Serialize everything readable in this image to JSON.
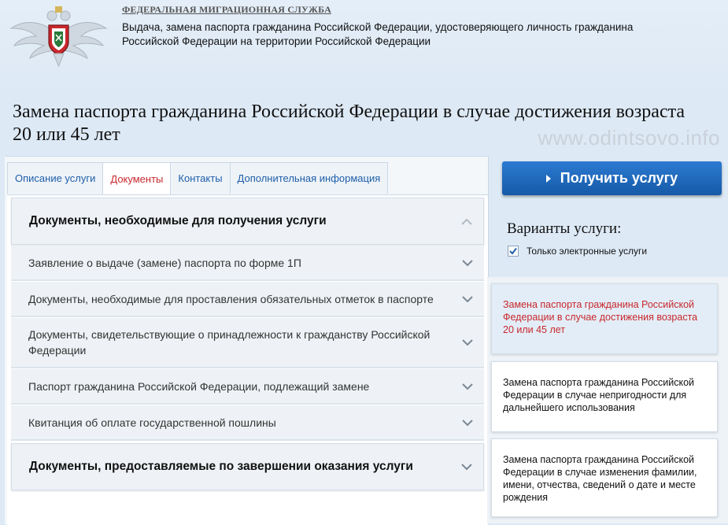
{
  "header": {
    "agency": "ФЕДЕРАЛЬНАЯ МИГРАЦИОННАЯ СЛУЖБА",
    "agency_desc": "Выдача, замена паспорта гражданина Российской Федерации, удостоверяющего личность гражданина Российской Федерации на территории Российской Федерации"
  },
  "page_title": "Замена паспорта гражданина Российской Федерации в случае достижения возраста 20 или 45 лет",
  "watermark": "www.odintsovo.info",
  "tabs": [
    {
      "label": "Описание услуги"
    },
    {
      "label": "Документы"
    },
    {
      "label": "Контакты"
    },
    {
      "label": "Дополнительная информация"
    }
  ],
  "sections": {
    "required_title": "Документы, необходимые для получения услуги",
    "items": [
      "Заявление о выдаче (замене) паспорта по форме 1П",
      "Документы, необходимые для проставления обязательных отметок в паспорте",
      "Документы, свидетельствующие о принадлежности к гражданству Российской Федерации",
      "Паспорт гражданина Российской Федерации, подлежащий замене",
      "Квитанция об оплате государственной пошлины"
    ],
    "completion_title": "Документы, предоставляемые по завершении оказания услуги"
  },
  "sidebar": {
    "get_service": "Получить услугу",
    "variants_title": "Варианты услуги:",
    "only_electronic": "Только электронные услуги",
    "options": [
      "Замена паспорта гражданина Российской Федерации в случае достижения возраста 20 или 45 лет",
      "Замена паспорта гражданина Российской Федерации в случае непригодности для дальнейшего использования",
      "Замена паспорта гражданина Российской Федерации в случае изменения фамилии, имени, отчества, сведений о дате и месте рождения"
    ]
  },
  "colors": {
    "accent_blue": "#1f5ea8",
    "active_red": "#c8282d"
  }
}
